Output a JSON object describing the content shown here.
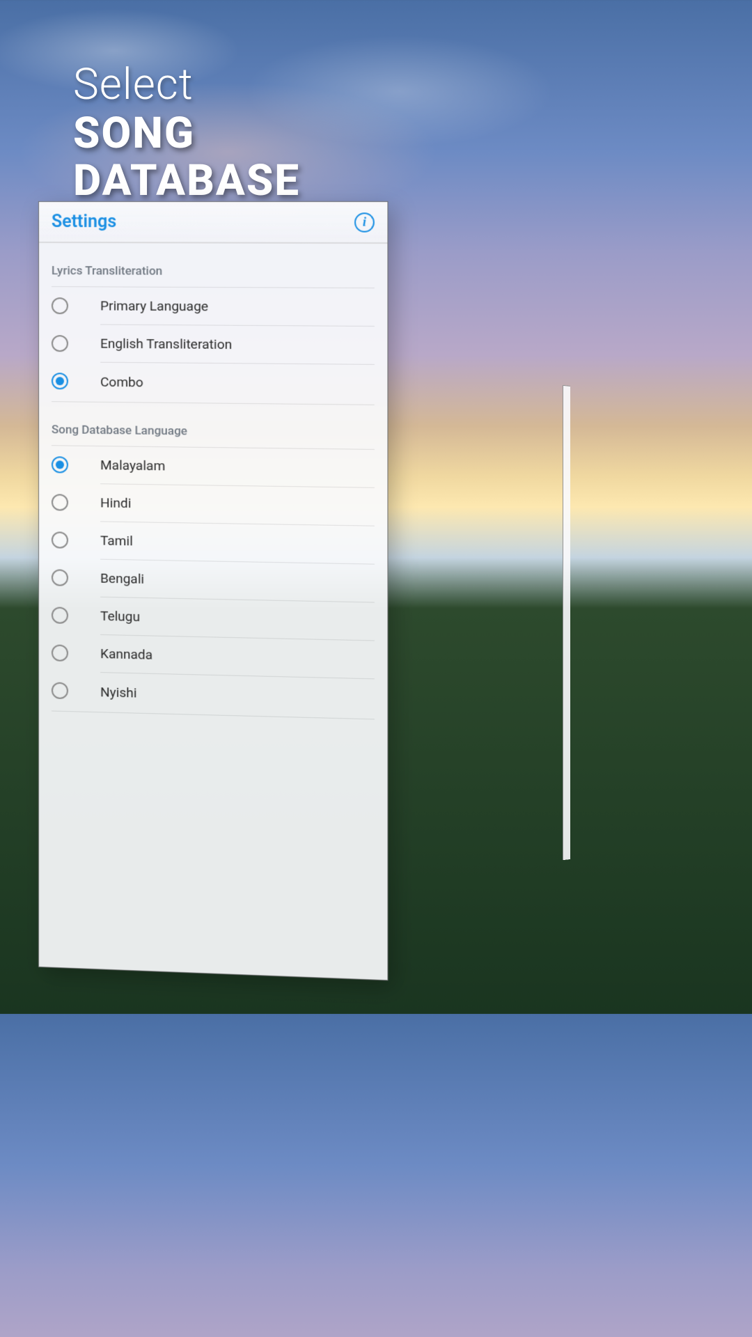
{
  "title": {
    "line1": "Select",
    "line2": "SONG",
    "line3": "DATABASE"
  },
  "panel": {
    "header": "Settings",
    "info_glyph": "i"
  },
  "sections": {
    "transliteration": {
      "title": "Lyrics Transliteration",
      "options": [
        {
          "label": "Primary Language",
          "selected": false
        },
        {
          "label": "English Transliteration",
          "selected": false
        },
        {
          "label": "Combo",
          "selected": true
        }
      ]
    },
    "database": {
      "title": "Song Database Language",
      "options": [
        {
          "label": "Malayalam",
          "selected": true
        },
        {
          "label": "Hindi",
          "selected": false
        },
        {
          "label": "Tamil",
          "selected": false
        },
        {
          "label": "Bengali",
          "selected": false
        },
        {
          "label": "Telugu",
          "selected": false
        },
        {
          "label": "Kannada",
          "selected": false
        },
        {
          "label": "Nyishi",
          "selected": false
        }
      ]
    }
  }
}
